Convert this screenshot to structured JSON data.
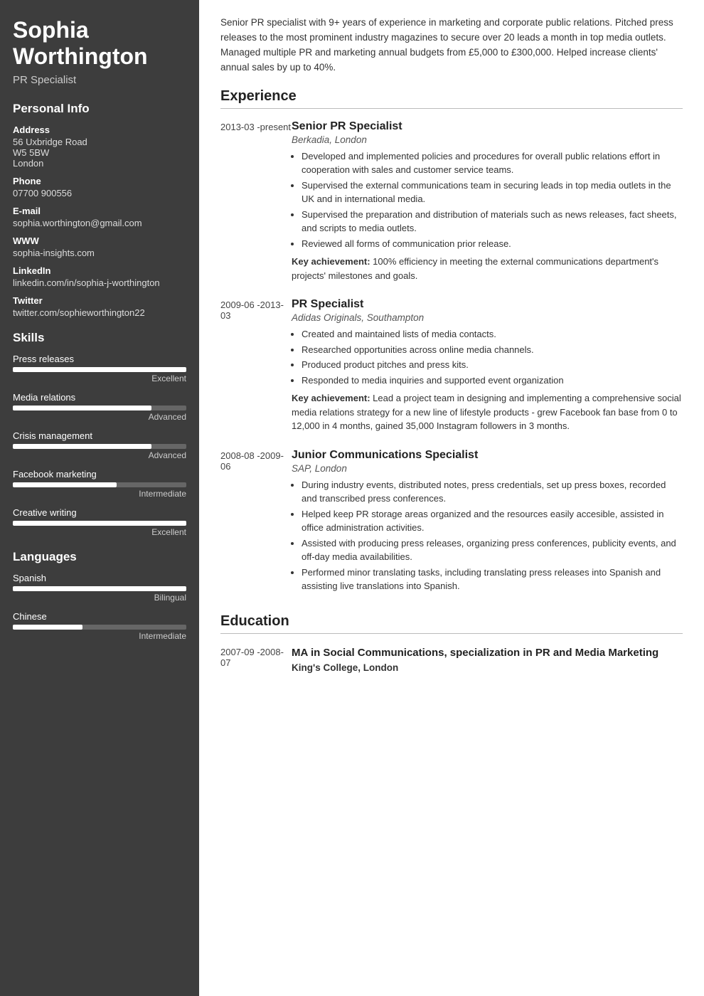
{
  "sidebar": {
    "name": "Sophia Worthington",
    "title": "PR Specialist",
    "personal_info_label": "Personal Info",
    "address_label": "Address",
    "address_lines": [
      "56 Uxbridge Road",
      "W5 5BW",
      "London"
    ],
    "phone_label": "Phone",
    "phone_value": "07700 900556",
    "email_label": "E-mail",
    "email_value": "sophia.worthington@gmail.com",
    "www_label": "WWW",
    "www_value": "sophia-insights.com",
    "linkedin_label": "LinkedIn",
    "linkedin_value": "linkedin.com/in/sophia-j-worthington",
    "twitter_label": "Twitter",
    "twitter_value": "twitter.com/sophieworthington22",
    "skills_label": "Skills",
    "skills": [
      {
        "name": "Press releases",
        "level_label": "Excellent",
        "fill_pct": 100
      },
      {
        "name": "Media relations",
        "level_label": "Advanced",
        "fill_pct": 80
      },
      {
        "name": "Crisis management",
        "level_label": "Advanced",
        "fill_pct": 80
      },
      {
        "name": "Facebook marketing",
        "level_label": "Intermediate",
        "fill_pct": 60
      },
      {
        "name": "Creative writing",
        "level_label": "Excellent",
        "fill_pct": 100
      }
    ],
    "languages_label": "Languages",
    "languages": [
      {
        "name": "Spanish",
        "level_label": "Bilingual",
        "fill_pct": 100
      },
      {
        "name": "Chinese",
        "level_label": "Intermediate",
        "fill_pct": 40
      }
    ]
  },
  "main": {
    "summary": "Senior PR specialist with 9+ years of experience in marketing and corporate public relations. Pitched press releases to the most prominent industry magazines to secure over 20 leads a month in top media outlets. Managed multiple PR and marketing annual budgets from £5,000 to £300,000. Helped increase clients' annual sales by up to 40%.",
    "experience_title": "Experience",
    "experience": [
      {
        "date": "2013-03 - present",
        "job_title": "Senior PR Specialist",
        "company": "Berkadia, London",
        "bullets": [
          "Developed and implemented policies and procedures for overall public relations effort in cooperation with sales and customer service teams.",
          "Supervised the external communications team in securing leads in top media outlets in the UK and in international media.",
          "Supervised the preparation and distribution of materials such as news releases, fact sheets, and scripts to media outlets.",
          "Reviewed all forms of communication prior release."
        ],
        "key_achievement": "100% efficiency in meeting the external communications department's projects' milestones and goals."
      },
      {
        "date": "2009-06 - 2013-03",
        "job_title": "PR Specialist",
        "company": "Adidas Originals, Southampton",
        "bullets": [
          "Created and maintained lists of media contacts.",
          "Researched opportunities across online media channels.",
          "Produced product pitches and press kits.",
          "Responded to media inquiries and supported event organization"
        ],
        "key_achievement": "Lead a project team in designing and implementing a comprehensive social media relations strategy for a new line of lifestyle products - grew Facebook fan base from 0 to 12,000 in 4 months, gained 35,000 Instagram followers in 3 months."
      },
      {
        "date": "2008-08 - 2009-06",
        "job_title": "Junior Communications Specialist",
        "company": "SAP, London",
        "bullets": [
          "During industry events, distributed notes, press credentials, set up press boxes, recorded and transcribed press conferences.",
          "Helped keep PR storage areas organized and the resources easily accesible, assisted in office administration activities.",
          "Assisted with producing press releases, organizing press conferences, publicity events, and off-day media availabilities.",
          "Performed minor translating tasks, including translating press releases into Spanish and assisting live translations into Spanish."
        ],
        "key_achievement": ""
      }
    ],
    "education_title": "Education",
    "education": [
      {
        "date": "2007-09 - 2008-07",
        "degree": "MA in Social Communications, specialization in PR and Media Marketing",
        "school": "King's College, London"
      }
    ]
  }
}
